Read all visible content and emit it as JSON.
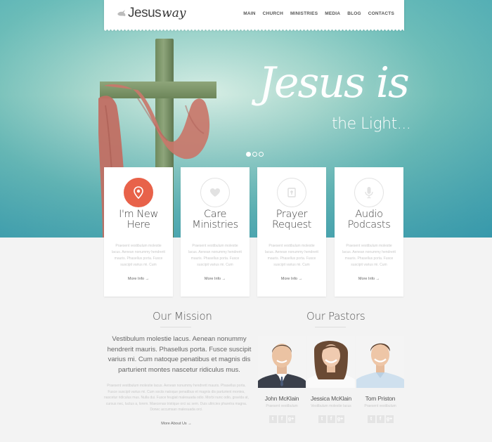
{
  "brand": {
    "name": "Jesus",
    "script": "way"
  },
  "nav": [
    "MAIN",
    "CHURCH",
    "MINISTRIES",
    "MEDIA",
    "BLOG",
    "CONTACTS"
  ],
  "hero": {
    "title": "Jesus is",
    "subtitle": "the Light...",
    "slides": 3,
    "active_slide": 0
  },
  "cards": [
    {
      "title_1": "I'm New",
      "title_2": "Here",
      "icon": "location-pin-icon",
      "text": "Praesent vestibulum molestie lacus. Aenean nonummy hendrerit mauris. Phasellus porta. Fusce suscipit varius mi. Cum",
      "more": "More Info →"
    },
    {
      "title_1": "Care",
      "title_2": "Ministries",
      "icon": "heart-icon",
      "text": "Praesent vestibulum molestie lacus. Aenean nonummy hendrerit mauris. Phasellus porta. Fusce suscipit varius mi. Cum",
      "more": "More Info →"
    },
    {
      "title_1": "Prayer",
      "title_2": "Request",
      "icon": "bible-icon",
      "text": "Praesent vestibulum molestie lacus. Aenean nonummy hendrerit mauris. Phasellus porta. Fusce suscipit varius mi. Cum",
      "more": "More Info →"
    },
    {
      "title_1": "Audio",
      "title_2": "Podcasts",
      "icon": "microphone-icon",
      "text": "Praesent vestibulum molestie lacus. Aenean nonummy hendrerit mauris. Phasellus porta. Fusce suscipit varius mi. Cum",
      "more": "More Info →"
    }
  ],
  "mission": {
    "title": "Our Mission",
    "lead": "Vestibulum molestie lacus. Aenean nonummy hendrerit mauris. Phasellus porta. Fusce suscipit varius mi. Cum natoque penatibus et magnis dis parturient montes nascetur ridiculus mus.",
    "body": "Praesent vestibulum molestie lacus. Aenean nonummy hendrerit mauris. Phasellus porta. Fusce suscipit varius mi. Cum sociis natoque penatibus et magnis dis parturient montes, nascetur ridiculus mus. Nulla dui. Fusce feugiat malesuada odio. Morbi nunc odio, gravida at, cursus nec, luctus a, lorem. Maecenas tristique orci ac sem. Duis ultricies pharetra magna. Donec accumsan malesuada orci.",
    "more": "More About Us →"
  },
  "pastors": {
    "title": "Our Pastors",
    "items": [
      {
        "name": "John McKlain",
        "role": "Praesent vestibulum"
      },
      {
        "name": "Jessica McKlain",
        "role": "Vestibulum molestie lacus"
      },
      {
        "name": "Tom Priston",
        "role": "Praesent vestibulum"
      }
    ],
    "social": [
      "t",
      "f",
      "g+"
    ]
  },
  "colors": {
    "accent": "#e8624a",
    "hero_teal": "#6fbdb7"
  }
}
